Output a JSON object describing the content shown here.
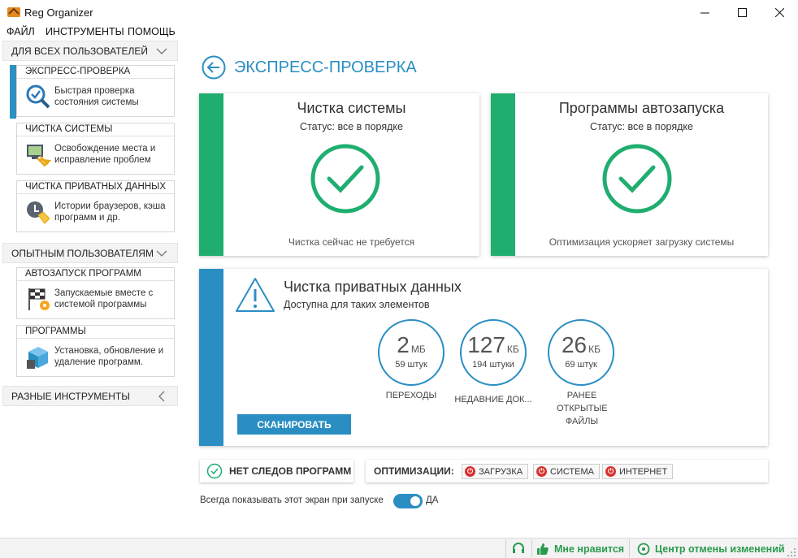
{
  "window": {
    "title": "Reg Organizer"
  },
  "menu": [
    {
      "label": "ФАЙЛ"
    },
    {
      "label": "ИНСТРУМЕНТЫ"
    },
    {
      "label": "ПОМОЩЬ"
    }
  ],
  "sidebar": {
    "groups": [
      {
        "label": "ДЛЯ ВСЕХ ПОЛЬЗОВАТЕЛЕЙ"
      },
      {
        "label": "ОПЫТНЫМ ПОЛЬЗОВАТЕЛЯМ"
      },
      {
        "label": "РАЗНЫЕ ИНСТРУМЕНТЫ"
      }
    ],
    "items": [
      {
        "title": "ЭКСПРЕСС-ПРОВЕРКА",
        "desc": "Быстрая проверка состояния системы",
        "icon": "magnifier-check-icon"
      },
      {
        "title": "ЧИСТКА СИСТЕМЫ",
        "desc": "Освобождение места и исправление проблем",
        "icon": "system-cleanup-icon"
      },
      {
        "title": "ЧИСТКА ПРИВАТНЫХ ДАННЫХ",
        "desc": "Истории браузеров, кэша программ и др.",
        "icon": "private-cleanup-icon"
      },
      {
        "title": "АВТОЗАПУСК ПРОГРАММ",
        "desc": "Запускаемые вместе с системой программы",
        "icon": "autorun-flag-icon"
      },
      {
        "title": "ПРОГРАММЫ",
        "desc": "Установка, обновление и удаление программ.",
        "icon": "programs-box-icon"
      }
    ]
  },
  "main": {
    "title": "ЭКСПРЕСС-ПРОВЕРКА",
    "cards": [
      {
        "title": "Чистка системы",
        "status": "Статус: все в порядке",
        "footer": "Чистка сейчас не требуется"
      },
      {
        "title": "Программы автозапуска",
        "status": "Статус: все в порядке",
        "footer": "Оптимизация ускоряет загрузку системы"
      }
    ],
    "private": {
      "title": "Чистка приватных данных",
      "subtitle": "Доступна для таких элементов",
      "stats": [
        {
          "value": "2",
          "unit": "МБ",
          "count": "59 штук",
          "label": "ПЕРЕХОДЫ"
        },
        {
          "value": "127",
          "unit": "КБ",
          "count": "194 штуки",
          "label": "НЕДАВНИЕ ДОК..."
        },
        {
          "value": "26",
          "unit": "КБ",
          "count": "69 штук",
          "label": "РАНЕЕ ОТКРЫТЫЕ ФАЙЛЫ"
        }
      ],
      "scan_label": "СКАНИРОВАТЬ"
    },
    "no_traces": "НЕТ СЛЕДОВ ПРОГРАММ",
    "optimizations_label": "ОПТИМИЗАЦИИ:",
    "optimizations": [
      {
        "label": "ЗАГРУЗКА"
      },
      {
        "label": "СИСТЕМА"
      },
      {
        "label": "ИНТЕРНЕТ"
      }
    ],
    "show_on_start": {
      "label": "Всегда показывать этот экран при запуске",
      "value": "ДА"
    }
  },
  "statusbar": {
    "like": "Мне нравится",
    "undo_center": "Центр отмены изменений"
  },
  "colors": {
    "green": "#1fae6f",
    "blue": "#2a8ec3",
    "red": "#d9302c"
  }
}
